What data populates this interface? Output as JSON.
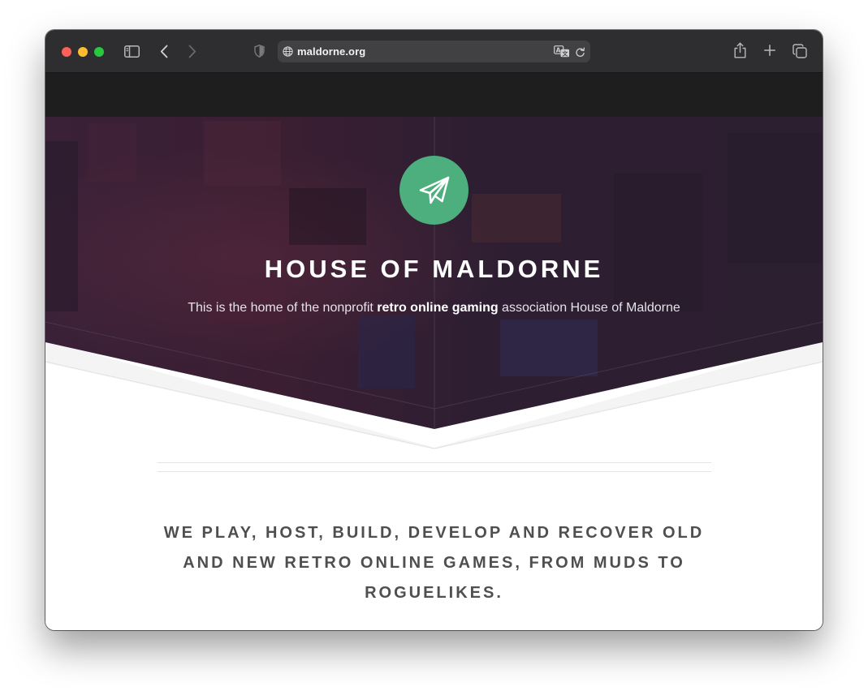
{
  "browser": {
    "url": "maldorne.org",
    "buttons": {
      "sidebar": "sidebar-icon",
      "back": "chevron-left-icon",
      "forward": "chevron-right-icon",
      "privacy": "shield-icon",
      "translate": "translate-icon",
      "reload": "reload-icon",
      "share": "share-icon",
      "new_tab": "plus-icon",
      "tab_overview": "tabs-icon"
    },
    "colors": {
      "toolbar": "#2e2e30",
      "address_bar": "#414144",
      "close": "#fe5f57",
      "minimize": "#febc2e",
      "zoom": "#28c840"
    }
  },
  "hero": {
    "logo_icon": "paper-plane-icon",
    "title": "HOUSE OF MALDORNE",
    "subtitle_before": "This is the home of the nonprofit ",
    "subtitle_bold": "retro online gaming",
    "subtitle_after": " association House of Maldorne",
    "colors": {
      "overlay": "#2d1e33",
      "logo_bg": "#4caf7d"
    }
  },
  "tagline": "WE PLAY, HOST, BUILD, DEVELOP AND RECOVER OLD AND NEW RETRO ONLINE GAMES, FROM MUDS TO ROGUELIKES."
}
